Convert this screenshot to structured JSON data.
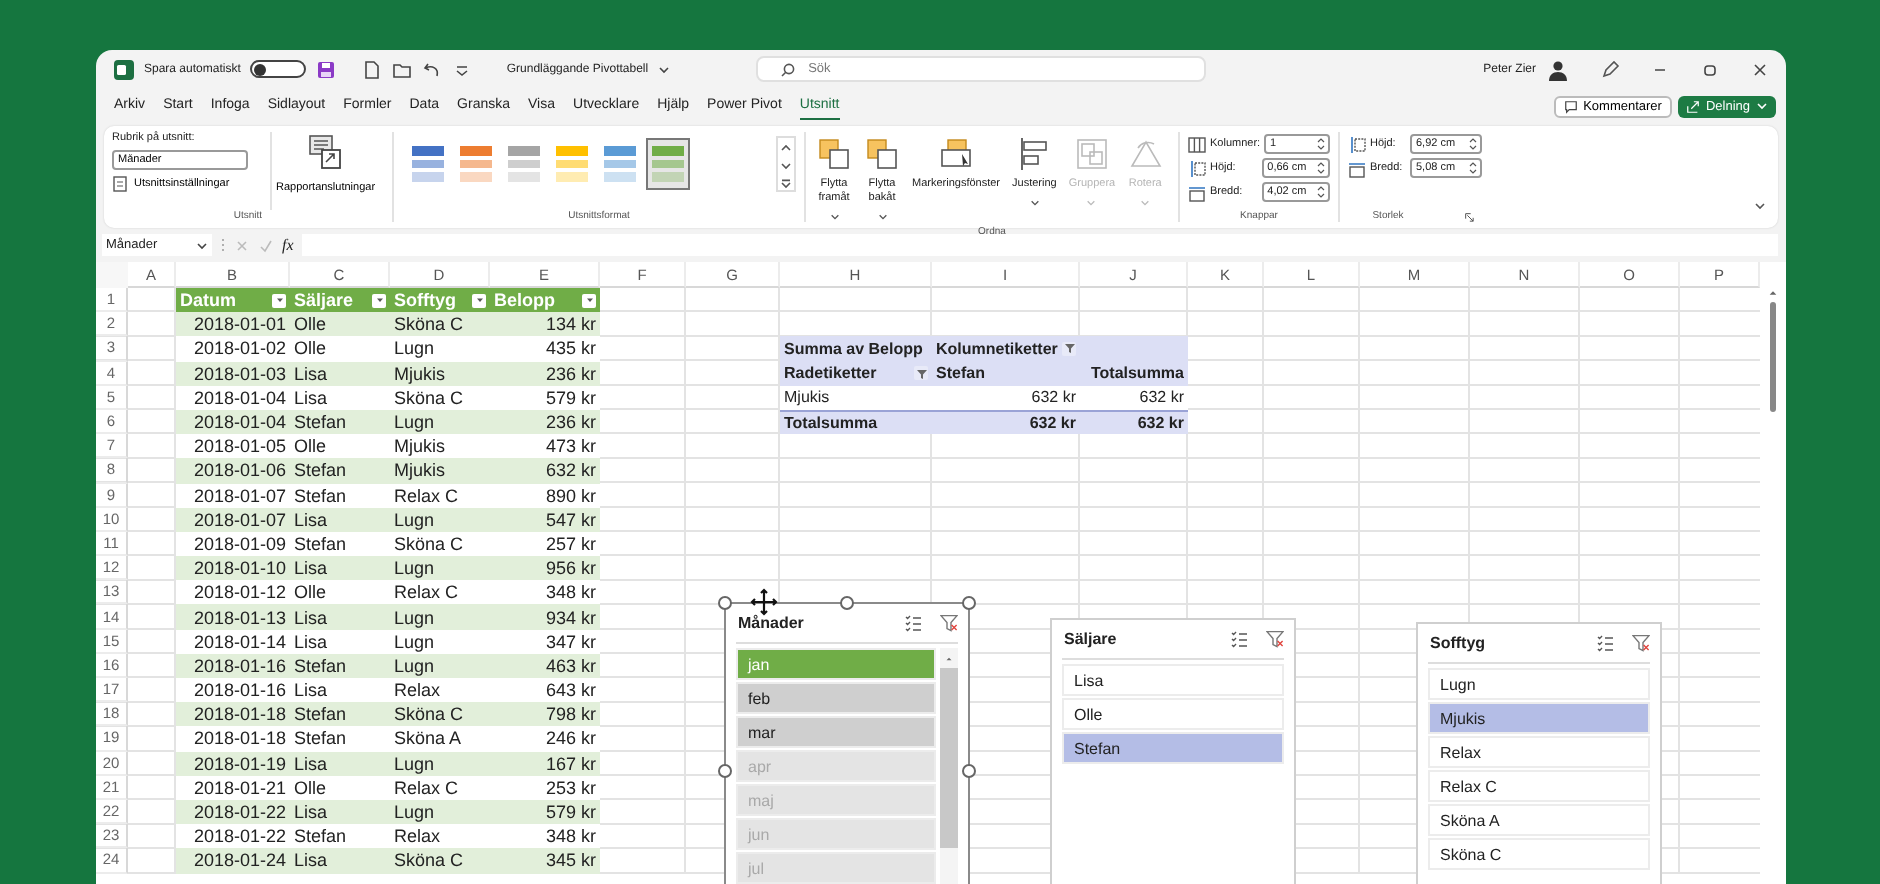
{
  "title_bar": {
    "autosave_label": "Spara automatiskt",
    "autosave_on": false,
    "file_name": "Grundläggande Pivottabell",
    "search_placeholder": "Sök",
    "user_name": "Peter Zier"
  },
  "menu_tabs": [
    {
      "label": "Arkiv",
      "selected": false
    },
    {
      "label": "Start",
      "selected": false
    },
    {
      "label": "Infoga",
      "selected": false
    },
    {
      "label": "Sidlayout",
      "selected": false
    },
    {
      "label": "Formler",
      "selected": false
    },
    {
      "label": "Data",
      "selected": false
    },
    {
      "label": "Granska",
      "selected": false
    },
    {
      "label": "Visa",
      "selected": false
    },
    {
      "label": "Utvecklare",
      "selected": false
    },
    {
      "label": "Hjälp",
      "selected": false
    },
    {
      "label": "Power Pivot",
      "selected": false
    },
    {
      "label": "Utsnitt",
      "selected": true
    }
  ],
  "comments_button": "Kommentarer",
  "share_button": "Delning",
  "ribbon": {
    "slicer": {
      "caption_label": "Rubrik på utsnitt:",
      "caption_value": "Månader",
      "settings_button": "Utsnittsinställningar",
      "connections_button": "Rapportanslutningar",
      "group_label": "Utsnitt"
    },
    "styles": {
      "swatches": [
        {
          "color": "#4472c4",
          "selected": false
        },
        {
          "color": "#ed7d31",
          "selected": false
        },
        {
          "color": "#a5a5a5",
          "selected": false
        },
        {
          "color": "#ffc000",
          "selected": false
        },
        {
          "color": "#5b9bd5",
          "selected": false
        },
        {
          "color": "#70ad47",
          "selected": true
        }
      ],
      "group_label": "Utsnittsformat"
    },
    "arrange": {
      "buttons": [
        {
          "kind": "forward",
          "lines": [
            "Flytta",
            "framåt"
          ],
          "dropdown": true,
          "disabled": false
        },
        {
          "kind": "backward",
          "lines": [
            "Flytta",
            "bakåt"
          ],
          "dropdown": true,
          "disabled": false
        },
        {
          "kind": "pane",
          "lines": [
            "Markeringsfönster"
          ],
          "dropdown": false,
          "disabled": false
        },
        {
          "kind": "align",
          "lines": [
            "Justering"
          ],
          "dropdown": true,
          "disabled": false
        },
        {
          "kind": "group",
          "lines": [
            "Gruppera"
          ],
          "dropdown": true,
          "disabled": true
        },
        {
          "kind": "rotate",
          "lines": [
            "Rotera"
          ],
          "dropdown": true,
          "disabled": true
        }
      ],
      "group_label": "Ordna"
    },
    "buttons_group": {
      "fields": [
        {
          "kind": "columns",
          "label": "Kolumner:",
          "value": "1"
        },
        {
          "kind": "height",
          "label": "Höjd:",
          "value": "0,66 cm"
        },
        {
          "kind": "width",
          "label": "Bredd:",
          "value": "4,02 cm"
        }
      ],
      "group_label": "Knappar"
    },
    "size": {
      "fields": [
        {
          "kind": "height",
          "label": "Höjd:",
          "value": "6,92 cm"
        },
        {
          "kind": "width",
          "label": "Bredd:",
          "value": "5,08 cm"
        }
      ],
      "group_label": "Storlek"
    }
  },
  "formula_bar": {
    "name_box": "Månader",
    "function_label": "fx"
  },
  "sheet": {
    "columns": [
      "A",
      "B",
      "C",
      "D",
      "E",
      "F",
      "G",
      "H",
      "I",
      "J",
      "K",
      "L",
      "M",
      "N",
      "O",
      "P"
    ],
    "row_numbers": [
      "1",
      "2",
      "3",
      "4",
      "5",
      "6",
      "7",
      "8",
      "9",
      "10",
      "11",
      "12",
      "13",
      "14",
      "15",
      "16",
      "17",
      "18",
      "19",
      "20",
      "21",
      "22",
      "23",
      "24"
    ]
  },
  "data_table": {
    "columns": [
      "Datum",
      "Säljare",
      "Sofftyg",
      "Belopp"
    ],
    "rows": [
      [
        "2018-01-01",
        "Olle",
        "Sköna C",
        "134 kr"
      ],
      [
        "2018-01-02",
        "Olle",
        "Lugn",
        "435 kr"
      ],
      [
        "2018-01-03",
        "Lisa",
        "Mjukis",
        "236 kr"
      ],
      [
        "2018-01-04",
        "Lisa",
        "Sköna C",
        "579 kr"
      ],
      [
        "2018-01-04",
        "Stefan",
        "Lugn",
        "236 kr"
      ],
      [
        "2018-01-05",
        "Olle",
        "Mjukis",
        "473 kr"
      ],
      [
        "2018-01-06",
        "Stefan",
        "Mjukis",
        "632 kr"
      ],
      [
        "2018-01-07",
        "Stefan",
        "Relax C",
        "890 kr"
      ],
      [
        "2018-01-07",
        "Lisa",
        "Lugn",
        "547 kr"
      ],
      [
        "2018-01-09",
        "Stefan",
        "Sköna C",
        "257 kr"
      ],
      [
        "2018-01-10",
        "Lisa",
        "Lugn",
        "956 kr"
      ],
      [
        "2018-01-12",
        "Olle",
        "Relax C",
        "348 kr"
      ],
      [
        "2018-01-13",
        "Lisa",
        "Lugn",
        "934 kr"
      ],
      [
        "2018-01-14",
        "Lisa",
        "Lugn",
        "347 kr"
      ],
      [
        "2018-01-16",
        "Stefan",
        "Lugn",
        "463 kr"
      ],
      [
        "2018-01-16",
        "Lisa",
        "Relax",
        "643 kr"
      ],
      [
        "2018-01-18",
        "Stefan",
        "Sköna C",
        "798 kr"
      ],
      [
        "2018-01-18",
        "Stefan",
        "Sköna A",
        "246 kr"
      ],
      [
        "2018-01-19",
        "Lisa",
        "Lugn",
        "167 kr"
      ],
      [
        "2018-01-21",
        "Olle",
        "Relax C",
        "253 kr"
      ],
      [
        "2018-01-22",
        "Lisa",
        "Lugn",
        "579 kr"
      ],
      [
        "2018-01-22",
        "Stefan",
        "Relax",
        "348 kr"
      ],
      [
        "2018-01-24",
        "Lisa",
        "Sköna C",
        "345 kr"
      ]
    ]
  },
  "pivot": {
    "rows": [
      {
        "kind": "header",
        "cells": [
          {
            "text": "Summa av Belopp",
            "filter": false
          },
          {
            "text": "Kolumnetiketter",
            "filter": true
          }
        ]
      },
      {
        "kind": "header",
        "cells": [
          {
            "text": "Radetiketter",
            "filter": true
          },
          {
            "text": "Stefan",
            "filter": false
          },
          {
            "text": "Totalsumma",
            "filter": false
          }
        ]
      },
      {
        "kind": "data",
        "cells": [
          {
            "text": "Mjukis",
            "filter": false
          },
          {
            "text": "632 kr",
            "filter": false
          },
          {
            "text": "632 kr",
            "filter": false
          }
        ]
      },
      {
        "kind": "total",
        "cells": [
          {
            "text": "Totalsumma",
            "filter": false
          },
          {
            "text": "632 kr",
            "filter": false
          },
          {
            "text": "632 kr",
            "filter": false
          }
        ]
      }
    ]
  },
  "slicers": [
    {
      "title": "Månader",
      "selected": true,
      "scrollable": true,
      "items": [
        {
          "label": "jan",
          "selected": true,
          "available": true
        },
        {
          "label": "feb",
          "selected": false,
          "available": true
        },
        {
          "label": "mar",
          "selected": false,
          "available": true
        },
        {
          "label": "apr",
          "selected": false,
          "available": false
        },
        {
          "label": "maj",
          "selected": false,
          "available": false
        },
        {
          "label": "jun",
          "selected": false,
          "available": false
        },
        {
          "label": "jul",
          "selected": false,
          "available": false
        }
      ]
    },
    {
      "title": "Säljare",
      "selected": false,
      "scrollable": false,
      "items": [
        {
          "label": "Lisa",
          "selected": false,
          "available": true
        },
        {
          "label": "Olle",
          "selected": false,
          "available": true
        },
        {
          "label": "Stefan",
          "selected": true,
          "available": true
        }
      ]
    },
    {
      "title": "Sofftyg",
      "selected": false,
      "scrollable": false,
      "items": [
        {
          "label": "Lugn",
          "selected": false,
          "available": true
        },
        {
          "label": "Mjukis",
          "selected": true,
          "available": true
        },
        {
          "label": "Relax",
          "selected": false,
          "available": true
        },
        {
          "label": "Relax C",
          "selected": false,
          "available": true
        },
        {
          "label": "Sköna A",
          "selected": false,
          "available": true
        },
        {
          "label": "Sköna C",
          "selected": false,
          "available": true
        }
      ]
    }
  ]
}
